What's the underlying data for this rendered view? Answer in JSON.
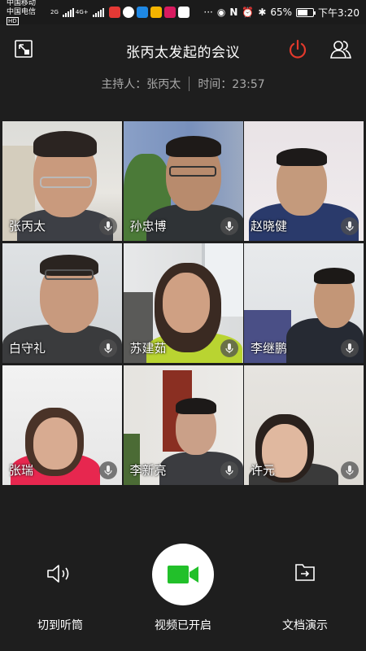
{
  "status_bar": {
    "carrier1": "中国移动",
    "carrier2": "中国电信",
    "carrier2_badge": "HD",
    "net1": "2G",
    "net2": "4G+",
    "battery": "65%",
    "battery_level": 0.65,
    "time": "下午3:20",
    "bluetooth": "✱"
  },
  "header": {
    "title": "张丙太发起的会议",
    "host_label": "主持人：张丙太",
    "time_label": "时间：23:57"
  },
  "participants": [
    {
      "name": "张丙太"
    },
    {
      "name": "孙忠博"
    },
    {
      "name": "赵晓健"
    },
    {
      "name": "白守礼"
    },
    {
      "name": "苏建茹"
    },
    {
      "name": "李继鹏"
    },
    {
      "name": "张瑞"
    },
    {
      "name": "李新亮"
    },
    {
      "name": "许元"
    }
  ],
  "controls": {
    "speaker_label": "切到听筒",
    "video_label": "视频已开启",
    "doc_label": "文档演示"
  },
  "colors": {
    "background": "#1e1e1e",
    "accent_red": "#e2392c",
    "video_green": "#22c02a"
  },
  "icons": [
    "exit-icon",
    "power-icon",
    "participants-icon",
    "mic-icon",
    "speaker-icon",
    "video-camera-icon",
    "document-share-icon"
  ]
}
